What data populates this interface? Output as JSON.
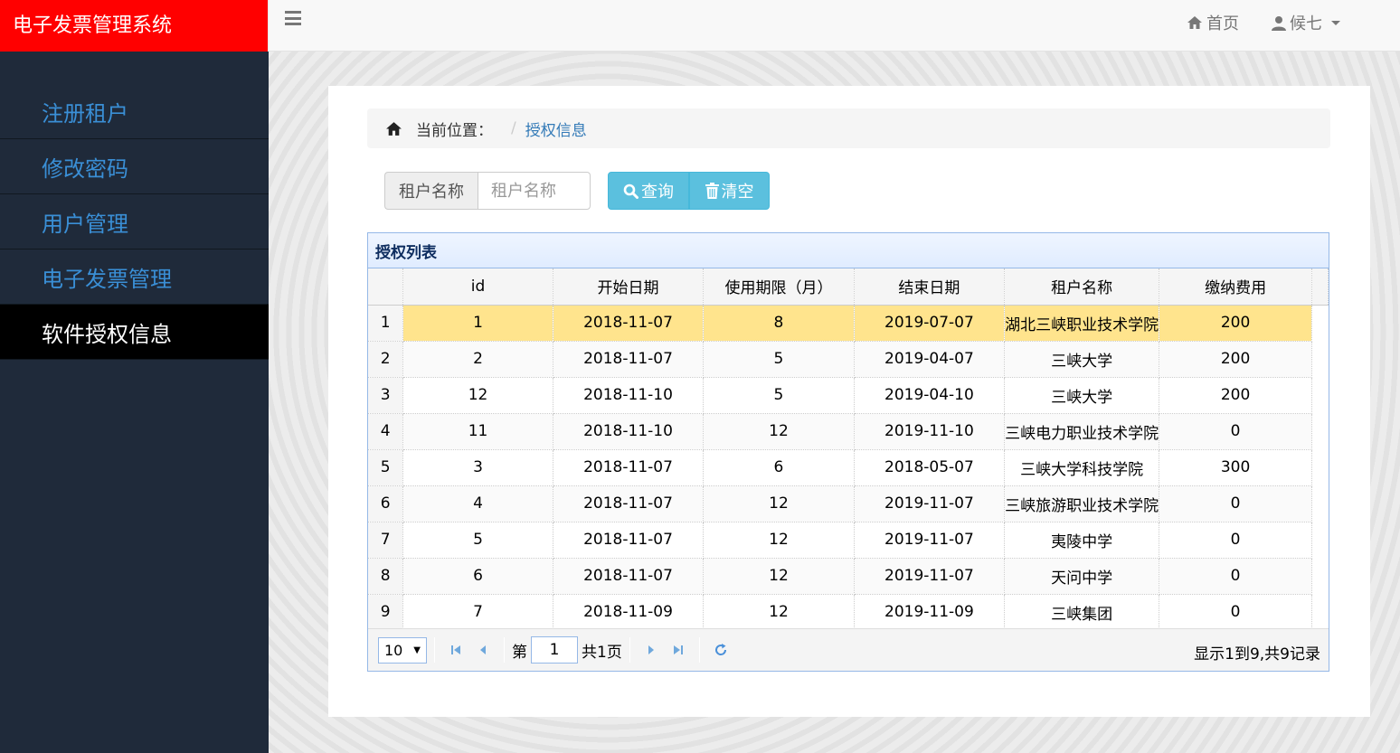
{
  "app": {
    "title": "电子发票管理系统"
  },
  "sidebar": {
    "items": [
      {
        "label": "注册租户"
      },
      {
        "label": "修改密码"
      },
      {
        "label": "用户管理"
      },
      {
        "label": "电子发票管理"
      },
      {
        "label": "软件授权信息",
        "active": true
      }
    ]
  },
  "topbar": {
    "home_label": "首页",
    "user_label": "候七"
  },
  "breadcrumb": {
    "prefix": "当前位置：",
    "separator": "/",
    "current": "授权信息"
  },
  "search": {
    "addon_label": "租户名称",
    "placeholder": "租户名称",
    "query_label": "查询",
    "clear_label": "清空"
  },
  "grid": {
    "title": "授权列表",
    "columns": [
      "id",
      "开始日期",
      "使用期限（月）",
      "结束日期",
      "租户名称",
      "缴纳费用"
    ],
    "rows": [
      {
        "n": "1",
        "cells": [
          "1",
          "2018-11-07",
          "8",
          "2019-07-07",
          "湖北三峡职业技术学院",
          "200"
        ]
      },
      {
        "n": "2",
        "cells": [
          "2",
          "2018-11-07",
          "5",
          "2019-04-07",
          "三峡大学",
          "200"
        ]
      },
      {
        "n": "3",
        "cells": [
          "12",
          "2018-11-10",
          "5",
          "2019-04-10",
          "三峡大学",
          "200"
        ]
      },
      {
        "n": "4",
        "cells": [
          "11",
          "2018-11-10",
          "12",
          "2019-11-10",
          "三峡电力职业技术学院",
          "0"
        ]
      },
      {
        "n": "5",
        "cells": [
          "3",
          "2018-11-07",
          "6",
          "2018-05-07",
          "三峡大学科技学院",
          "300"
        ]
      },
      {
        "n": "6",
        "cells": [
          "4",
          "2018-11-07",
          "12",
          "2019-11-07",
          "三峡旅游职业技术学院",
          "0"
        ]
      },
      {
        "n": "7",
        "cells": [
          "5",
          "2018-11-07",
          "12",
          "2019-11-07",
          "夷陵中学",
          "0"
        ]
      },
      {
        "n": "8",
        "cells": [
          "6",
          "2018-11-07",
          "12",
          "2019-11-07",
          "天问中学",
          "0"
        ]
      },
      {
        "n": "9",
        "cells": [
          "7",
          "2018-11-09",
          "12",
          "2019-11-09",
          "三峡集团",
          "0"
        ]
      }
    ],
    "selected_row": 0
  },
  "pager": {
    "page_size": "10",
    "page_prefix": "第",
    "page_value": "1",
    "page_suffix": "共1页",
    "info": "显示1到9,共9记录"
  },
  "colors": {
    "brand": "#ff0000",
    "sidebar_bg": "#1f2a3a",
    "link": "#3a8fd6",
    "info_button": "#5bc0de",
    "selected_row": "#ffe48d"
  }
}
